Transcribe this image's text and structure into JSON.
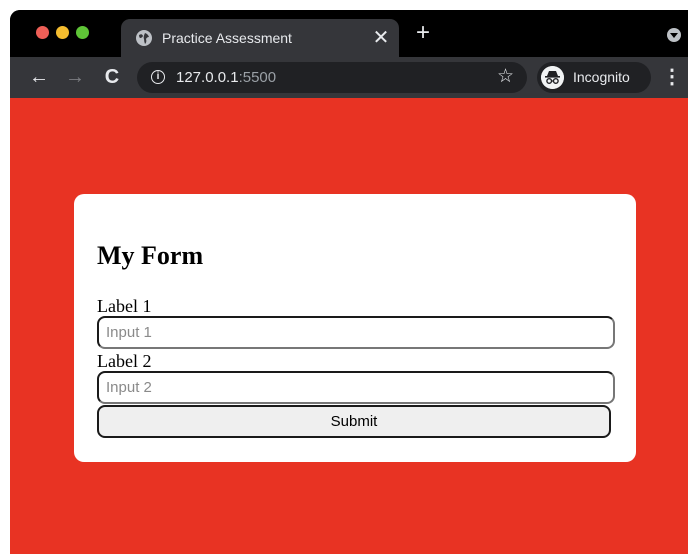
{
  "browser": {
    "tab": {
      "title": "Practice Assessment",
      "icon": "globe-icon",
      "close": "✕"
    },
    "new_tab": "+",
    "toolbar": {
      "back": "←",
      "forward": "→",
      "reload": "C",
      "url_host": "127.0.0.1",
      "url_port": ":5500",
      "bookmark": "☆",
      "profile_label": "Incognito",
      "menu": "⋮"
    }
  },
  "page": {
    "background_color": "#e83323",
    "form": {
      "title": "My Form",
      "fields": [
        {
          "label": "Label 1",
          "placeholder": "Input 1",
          "value": ""
        },
        {
          "label": "Label 2",
          "placeholder": "Input 2",
          "value": ""
        }
      ],
      "submit_label": "Submit"
    }
  }
}
